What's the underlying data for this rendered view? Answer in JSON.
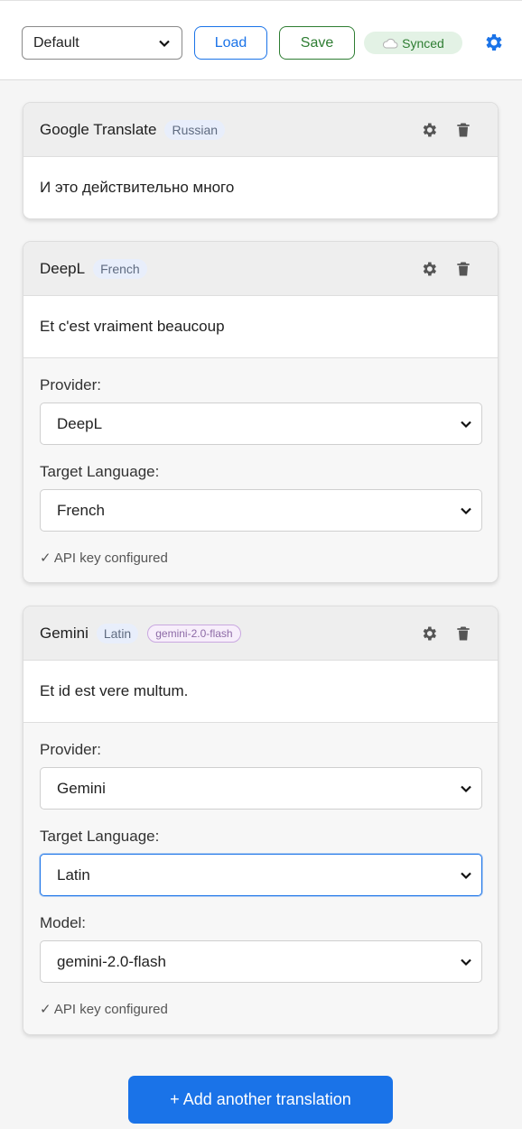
{
  "toolbar": {
    "preset_value": "Default",
    "load_label": "Load",
    "save_label": "Save",
    "synced_label": "Synced",
    "synced_icon": "cloud-icon",
    "settings_icon": "gear-icon"
  },
  "cards": [
    {
      "provider": "Google Translate",
      "language": "Russian",
      "text": "И это действительно много"
    },
    {
      "provider": "DeepL",
      "language": "French",
      "text": "Et c'est vraiment beaucoup",
      "settings": {
        "provider_label": "Provider:",
        "provider_value": "DeepL",
        "language_label": "Target Language:",
        "language_value": "French",
        "api_note": "✓ API key configured"
      }
    },
    {
      "provider": "Gemini",
      "language": "Latin",
      "model_badge": "gemini-2.0-flash",
      "text": "Et id est vere multum.",
      "settings": {
        "provider_label": "Provider:",
        "provider_value": "Gemini",
        "language_label": "Target Language:",
        "language_value": "Latin",
        "model_label": "Model:",
        "model_value": "gemini-2.0-flash",
        "api_note": "✓ API key configured"
      }
    }
  ],
  "add_button_label": "+ Add another translation",
  "colors": {
    "accent": "#1a73e8",
    "save": "#2e7d32",
    "synced_bg": "#e3f2e5"
  }
}
